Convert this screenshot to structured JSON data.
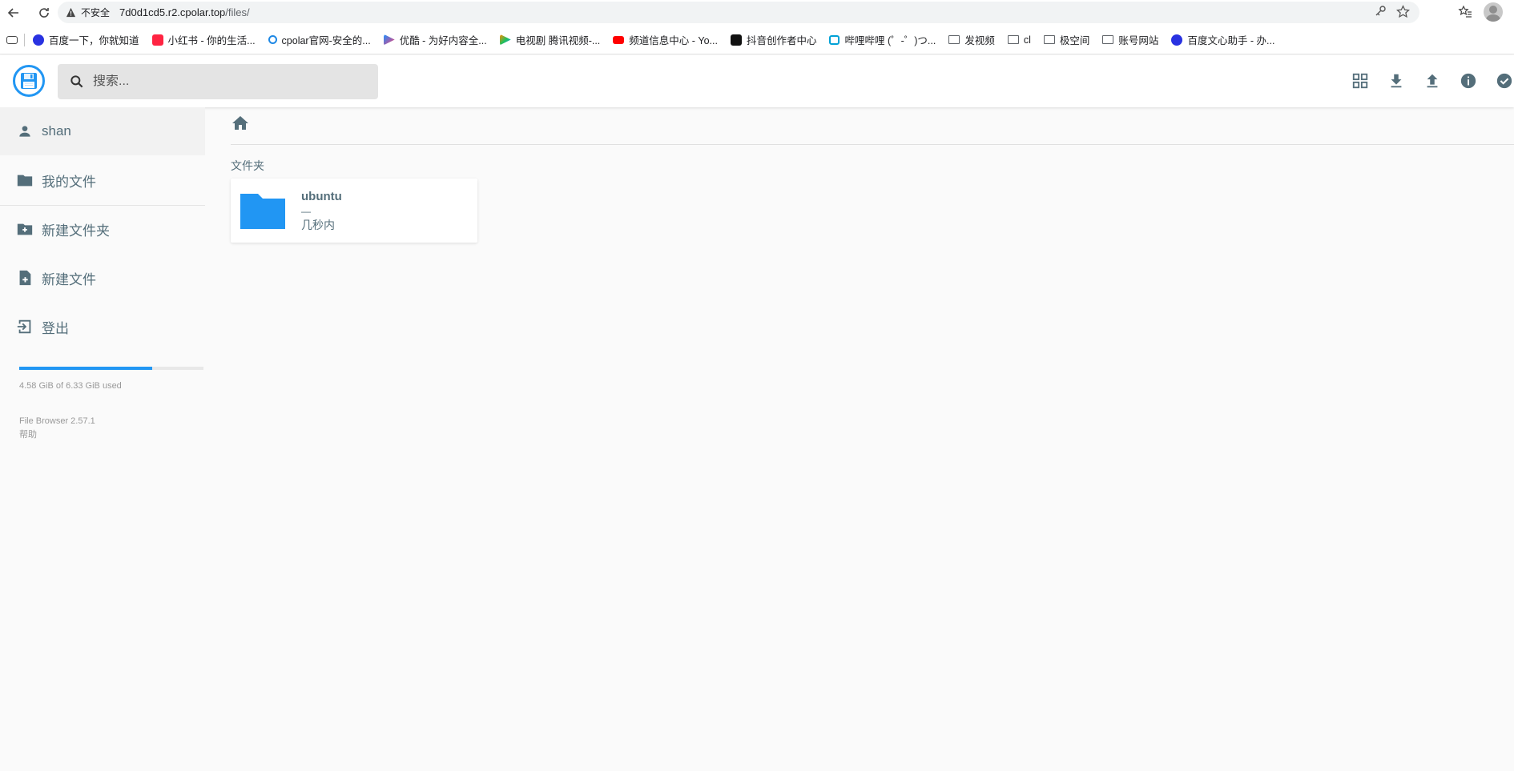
{
  "browser": {
    "security_label": "不安全",
    "url_host": "7d0d1cd5.r2.cpolar.top",
    "url_path": "/files/",
    "bookmarks": [
      {
        "label": "百度一下，你就知道",
        "icon": "baidu-icon",
        "color": "#2932e1"
      },
      {
        "label": "小红书 - 你的生活...",
        "icon": "xiaohongshu-icon",
        "color": "#ff2442"
      },
      {
        "label": "cpolar官网-安全的...",
        "icon": "cpolar-icon",
        "color": "#1e88e5"
      },
      {
        "label": "优酷 - 为好内容全...",
        "icon": "youku-icon",
        "color": "#1e90ff"
      },
      {
        "label": "电视剧 腾讯视频-...",
        "icon": "tencent-video-icon",
        "color": "#ff8a00"
      },
      {
        "label": "频道信息中心 - Yo...",
        "icon": "youtube-icon",
        "color": "#ff0000"
      },
      {
        "label": "抖音创作者中心",
        "icon": "douyin-icon",
        "color": "#111111"
      },
      {
        "label": "哔哩哔哩 (゜-゜)つ...",
        "icon": "bilibili-icon",
        "color": "#00a1d6"
      },
      {
        "label": "发视频",
        "icon": "folder-icon",
        "color": "#5f6368"
      },
      {
        "label": "cl",
        "icon": "folder-icon",
        "color": "#5f6368"
      },
      {
        "label": "极空间",
        "icon": "folder-icon",
        "color": "#5f6368"
      },
      {
        "label": "账号网站",
        "icon": "folder-icon",
        "color": "#5f6368"
      },
      {
        "label": "百度文心助手 - 办...",
        "icon": "baidu-icon",
        "color": "#2932e1"
      }
    ]
  },
  "header": {
    "search_placeholder": "搜索...",
    "actions": [
      "grid-view-icon",
      "download-icon",
      "upload-icon",
      "info-icon",
      "check-circle-icon"
    ]
  },
  "sidebar": {
    "user": "shan",
    "items": [
      {
        "label": "我的文件",
        "icon": "folder-icon"
      },
      {
        "label": "新建文件夹",
        "icon": "create-new-folder-icon"
      },
      {
        "label": "新建文件",
        "icon": "note-add-icon"
      },
      {
        "label": "登出",
        "icon": "logout-icon"
      }
    ],
    "usage_text": "4.58 GiB of 6.33 GiB used",
    "usage_fraction": 0.72,
    "version": "File Browser 2.57.1",
    "help": "帮助"
  },
  "main": {
    "section_title": "文件夹",
    "folders": [
      {
        "name": "ubuntu",
        "size": "—",
        "modified": "几秒内"
      }
    ]
  },
  "colors": {
    "accent": "#2196f3",
    "text": "#546e7a"
  }
}
